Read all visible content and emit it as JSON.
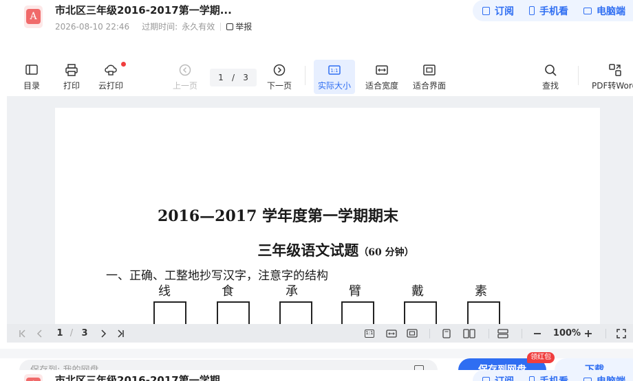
{
  "header": {
    "title": "市北区三年级2016-2017第一学期...",
    "date": "2026-08-10 22:46",
    "expire_label": "过期时间:",
    "expire_value": "永久有效",
    "report": "举报",
    "pdf_icon": "pdf-file-icon",
    "actions": [
      {
        "label": "订阅",
        "icon": "bookmark-icon"
      },
      {
        "label": "手机看",
        "icon": "phone-icon"
      },
      {
        "label": "电脑端",
        "icon": "monitor-icon"
      }
    ]
  },
  "toolbar": {
    "catalog": "目录",
    "print": "打印",
    "cloud_print": "云打印",
    "prev_page": "上一页",
    "current_page": "1",
    "page_sep": "/",
    "total_pages": "3",
    "next_page": "下一页",
    "actual_size": "实际大小",
    "fit_width": "适合宽度",
    "fit_page": "适合界面",
    "search": "查找",
    "pdf_to_word": "PDF转Word"
  },
  "document": {
    "title_line1": "2016—2017 学年度第一学期期末",
    "title_line2": "三年级语文试题",
    "title_line2_suffix": "（60 分钟）",
    "question1": "一、正确、工整地抄写汉字，注意字的结构",
    "chars": [
      "线",
      "食",
      "承",
      "臂",
      "戴",
      "素"
    ]
  },
  "page_bar": {
    "current": "1",
    "sep": "/",
    "total": "3",
    "zoom": "100%",
    "actual_icon_text": "1:1"
  },
  "footer": {
    "save_path": "保存到: 我的网盘",
    "save_button": "保存到网盘",
    "redpack": "领红包",
    "download": "下载"
  },
  "colors": {
    "accent": "#2f6ef2",
    "pdf_red": "#f06a6a",
    "badge_red": "#f03e3e"
  }
}
